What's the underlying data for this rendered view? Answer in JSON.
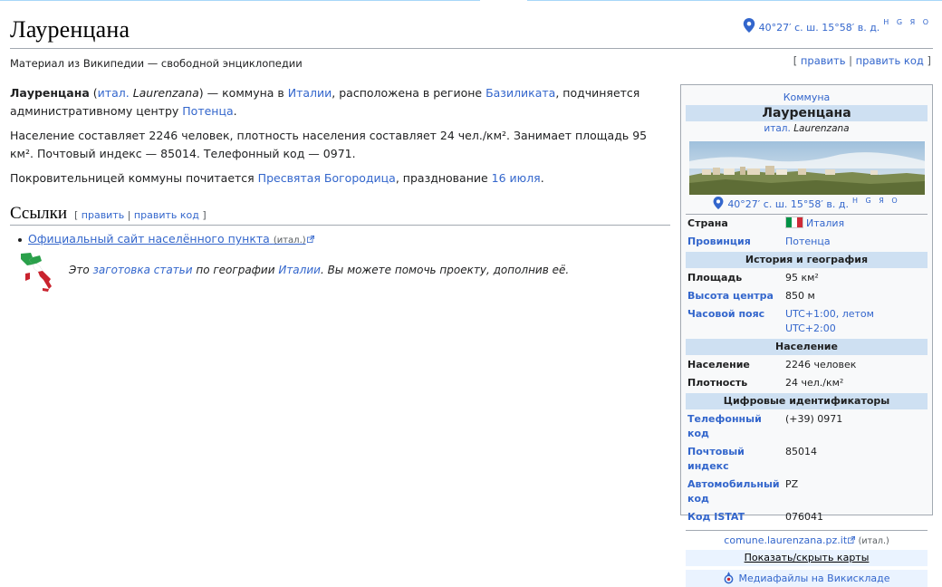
{
  "page": {
    "title": "Лауренцана",
    "tagline": "Материал из Википедии — свободной энциклопедии",
    "coords": "40°27′ с. ш. 15°58′ в. д.",
    "coords_links": "H G Я O",
    "edit": {
      "open": "[ ",
      "edit": "править",
      "sep": " | ",
      "edit_code": "править код",
      "close": " ]"
    }
  },
  "article": {
    "p1": {
      "name": "Лауренцана",
      "lang_abbr": "итал.",
      "lang_name": "Laurenzana",
      "t1": " — коммуна в ",
      "country": "Италии",
      "t2": ", расположена в регионе ",
      "region": "Базиликата",
      "t3": ", подчиняется административному центру ",
      "center": "Потенца",
      "t4": "."
    },
    "p2": "Население составляет 2246 человек, плотность населения составляет 24 чел./км². Занимает площадь 95 км². Почтовый индекс — 85014. Телефонный код — 0971.",
    "p3": {
      "t1": "Покровительницей коммуны почитается ",
      "saint": "Пресвятая Богородица",
      "t2": ", празднование ",
      "date": "16 июля",
      "t3": "."
    }
  },
  "links_section": {
    "heading": "Ссылки",
    "edit": "править",
    "edit_code": "править код",
    "item": "Официальный сайт населённого пункта",
    "item_lang": "(итал.)"
  },
  "stub": {
    "t1": "Это ",
    "link1": "заготовка статьи",
    "t2": " по географии ",
    "link2": "Италии",
    "t3": ". Вы можете помочь проекту, дополнив её."
  },
  "infobox": {
    "kind": "Коммуна",
    "name": "Лауренцана",
    "orig_lang": "итал.",
    "orig_name": "Laurenzana",
    "coords": "40°27′ с. ш. 15°58′ в. д.",
    "coords_links": "H G Я O",
    "rows_top": [
      {
        "k": "Страна",
        "v": "Италия"
      },
      {
        "k": "Провинция",
        "v": "Потенца"
      }
    ],
    "sect1": "История и география",
    "rows_geo": [
      {
        "k": "Площадь",
        "v": "95 км²"
      },
      {
        "k": "Высота центра",
        "v": "850 м"
      },
      {
        "k": "Часовой пояс",
        "v": "UTC+1:00, летом UTC+2:00"
      }
    ],
    "sect2": "Население",
    "rows_pop": [
      {
        "k": "Население",
        "v": "2246 человек"
      },
      {
        "k": "Плотность",
        "v": "24 чел./км²"
      }
    ],
    "sect3": "Цифровые идентификаторы",
    "rows_ids": [
      {
        "k": "Телефонный код",
        "v": "(+39) 0971"
      },
      {
        "k": "Почтовый индекс",
        "v": "85014"
      },
      {
        "k": "Автомобильный код",
        "v": "PZ"
      },
      {
        "k": "Код ISTAT",
        "v": "076041"
      }
    ],
    "site": "comune.laurenzana.pz.it",
    "site_lang": "(итал.)",
    "btn_map": "Показать/скрыть карты",
    "btn_commons": "Медиафайлы на Викискладе"
  }
}
